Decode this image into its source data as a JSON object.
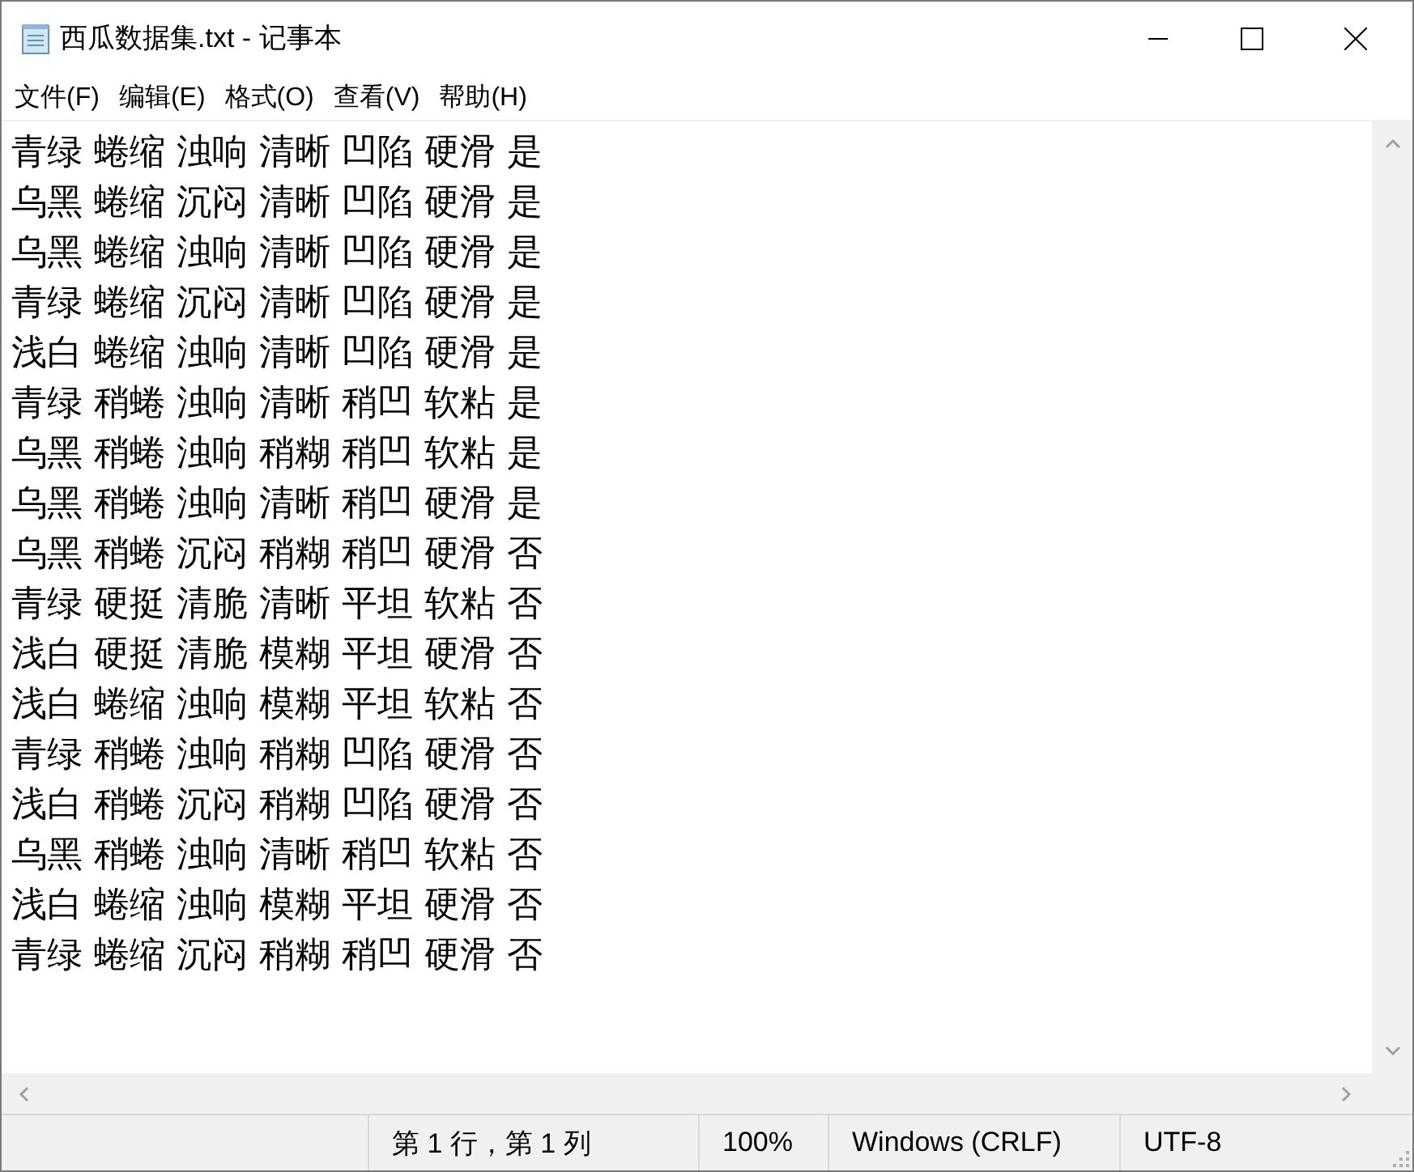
{
  "window": {
    "title": "西瓜数据集.txt - 记事本"
  },
  "menu": [
    "文件(F)",
    "编辑(E)",
    "格式(O)",
    "查看(V)",
    "帮助(H)"
  ],
  "lines": [
    "青绿 蜷缩 浊响 清晰 凹陷 硬滑 是",
    "乌黑 蜷缩 沉闷 清晰 凹陷 硬滑 是",
    "乌黑 蜷缩 浊响 清晰 凹陷 硬滑 是",
    "青绿 蜷缩 沉闷 清晰 凹陷 硬滑 是",
    "浅白 蜷缩 浊响 清晰 凹陷 硬滑 是",
    "青绿 稍蜷 浊响 清晰 稍凹 软粘 是",
    "乌黑 稍蜷 浊响 稍糊 稍凹 软粘 是",
    "乌黑 稍蜷 浊响 清晰 稍凹 硬滑 是",
    "乌黑 稍蜷 沉闷 稍糊 稍凹 硬滑 否",
    "青绿 硬挺 清脆 清晰 平坦 软粘 否",
    "浅白 硬挺 清脆 模糊 平坦 硬滑 否",
    "浅白 蜷缩 浊响 模糊 平坦 软粘 否",
    "青绿 稍蜷 浊响 稍糊 凹陷 硬滑 否",
    "浅白 稍蜷 沉闷 稍糊 凹陷 硬滑 否",
    "乌黑 稍蜷 浊响 清晰 稍凹 软粘 否",
    "浅白 蜷缩 浊响 模糊 平坦 硬滑 否",
    "青绿 蜷缩 沉闷 稍糊 稍凹 硬滑 否"
  ],
  "status_bar": [
    "第 1 行，第 1 列",
    "100%",
    "Windows (CRLF)",
    "UTF-8"
  ]
}
